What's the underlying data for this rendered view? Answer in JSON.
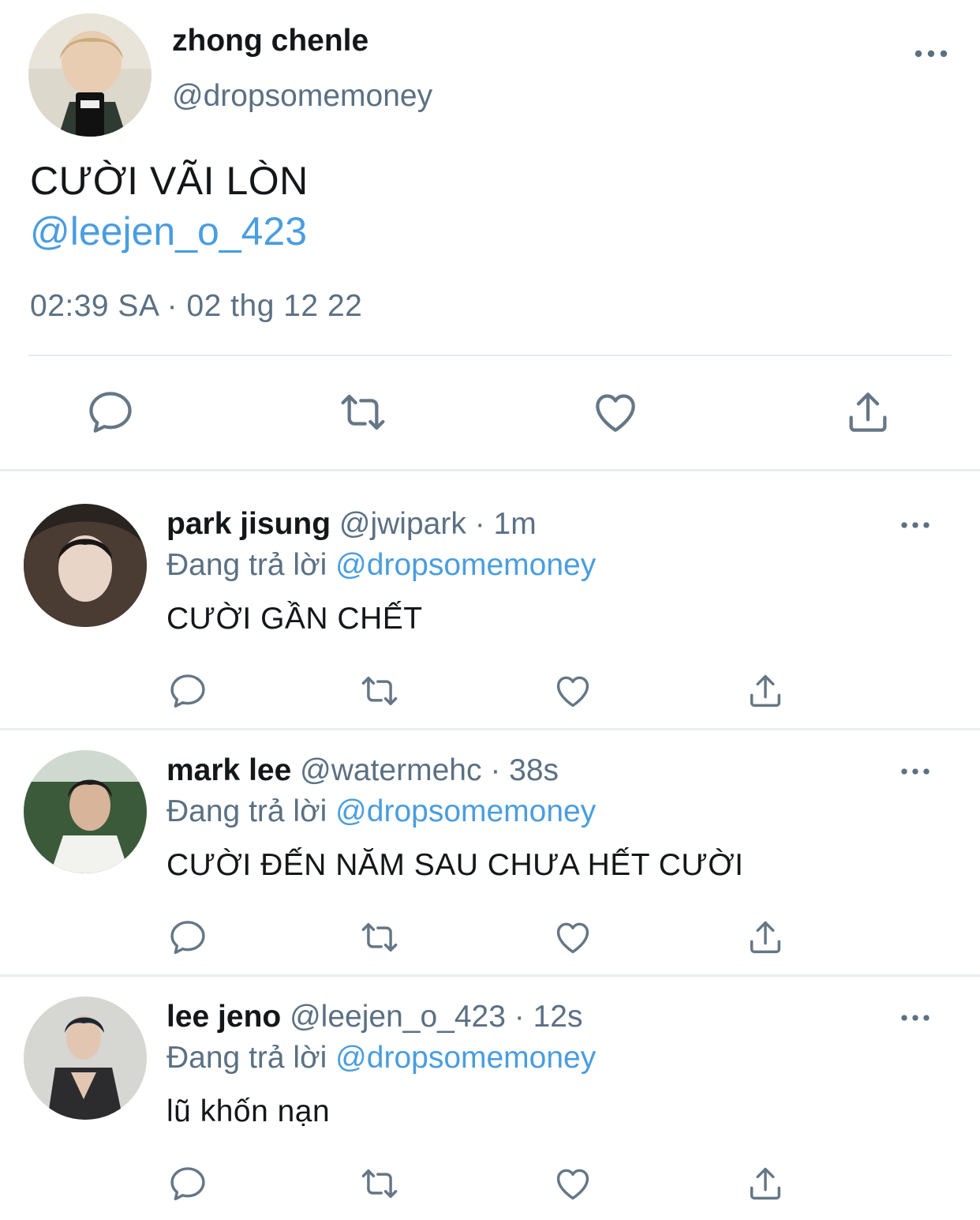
{
  "main_tweet": {
    "author_name": "zhong chenle",
    "author_handle": "@dropsomemoney",
    "text": "CƯỜI VÃI LÒN",
    "mention": "@leejen_o_423",
    "timestamp": "02:39 SA · 02 thg 12 22",
    "actions": [
      "reply-icon",
      "retweet-icon",
      "like-icon",
      "share-icon"
    ]
  },
  "replies": [
    {
      "name": "park jisung",
      "handle": "@jwipark",
      "time": "· 1m",
      "replying_label": "Đang trả lời",
      "replying_to": "@dropsomemoney",
      "text": "CƯỜI GẦN CHẾT"
    },
    {
      "name": "mark lee",
      "handle": "@watermehc",
      "time": "· 38s",
      "replying_label": "Đang trả lời",
      "replying_to": "@dropsomemoney",
      "text": "CƯỜI ĐẾN NĂM SAU CHƯA HẾT CƯỜI"
    },
    {
      "name": "lee jeno",
      "handle": "@leejen_o_423",
      "time": "· 12s",
      "replying_label": "Đang trả lời",
      "replying_to": "@dropsomemoney",
      "text": "lũ khốn nạn"
    }
  ],
  "colors": {
    "text": "#14171a",
    "secondary": "#5b7083",
    "link": "#4a9de0",
    "divider": "#e6ecf0"
  }
}
